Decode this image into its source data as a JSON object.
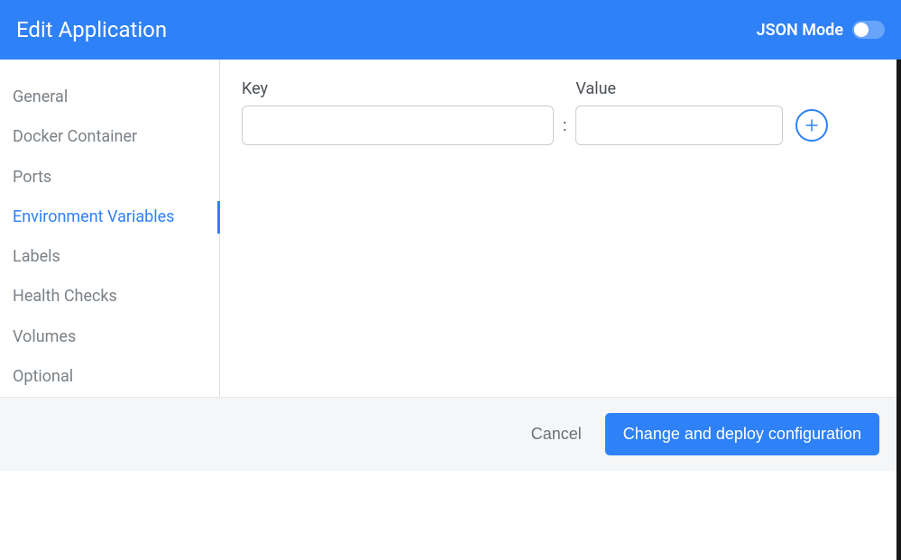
{
  "header": {
    "title": "Edit Application",
    "json_mode_label": "JSON Mode",
    "json_mode_on": false
  },
  "sidebar": {
    "items": [
      {
        "label": "General",
        "active": false
      },
      {
        "label": "Docker Container",
        "active": false
      },
      {
        "label": "Ports",
        "active": false
      },
      {
        "label": "Environment Variables",
        "active": true
      },
      {
        "label": "Labels",
        "active": false
      },
      {
        "label": "Health Checks",
        "active": false
      },
      {
        "label": "Volumes",
        "active": false
      },
      {
        "label": "Optional",
        "active": false
      }
    ]
  },
  "main": {
    "key_label": "Key",
    "value_label": "Value",
    "rows": [
      {
        "key": "",
        "value": ""
      }
    ],
    "separator": ":"
  },
  "footer": {
    "cancel_label": "Cancel",
    "submit_label": "Change and deploy configuration"
  },
  "colors": {
    "brand": "#2f81f7",
    "muted_text": "#7a8187",
    "border": "#c9ced3",
    "footer_bg": "#f5f6f7"
  }
}
